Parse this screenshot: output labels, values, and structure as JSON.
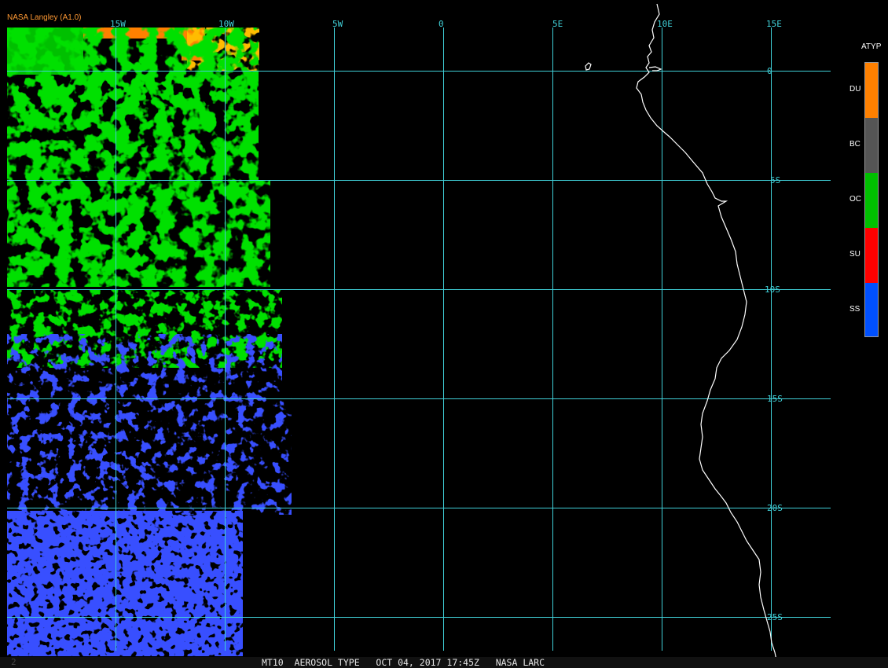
{
  "source_label": "NASA Langley (A1.0)",
  "footer": {
    "index": "2",
    "text": "MT10  AEROSOL TYPE   OCT 04, 2017 17:45Z   NASA LARC"
  },
  "grid": {
    "lon_labels": [
      "15W",
      "10W",
      "5W",
      "0",
      "5E",
      "10E",
      "15E"
    ],
    "lat_labels": [
      "0",
      "5S",
      "10S",
      "15S",
      "20S",
      "25S"
    ]
  },
  "legend": {
    "title": "ATYP",
    "items": [
      {
        "label": "DU",
        "color": "#ff8000"
      },
      {
        "label": "BC",
        "color": "#555555"
      },
      {
        "label": "OC",
        "color": "#00c000"
      },
      {
        "label": "SU",
        "color": "#ff0000"
      },
      {
        "label": "SS",
        "color": "#0050ff"
      }
    ]
  },
  "colors": {
    "grid": "#40d0d8",
    "background": "#000000",
    "coast": "#ffffff",
    "dust": "#ff8000",
    "organic_carbon": "#00c000",
    "sea_salt": "#0a14ff"
  }
}
